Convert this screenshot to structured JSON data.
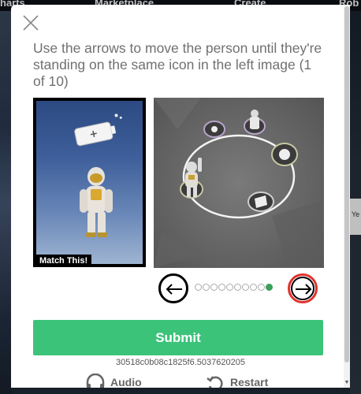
{
  "background_nav": {
    "items": [
      "harts",
      "Marketplace",
      "Create",
      "Rob"
    ]
  },
  "background_tile_text": "Ye",
  "modal": {
    "instructions": "Use the arrows to move the person until they're standing on the same icon in the left image (1 of 10)",
    "match_label": "Match This!",
    "submit_label": "Submit",
    "session_id": "30518c0b08c1825f6.5037620205",
    "audio_label": "Audio",
    "restart_label": "Restart",
    "progress": {
      "total": 10,
      "current": 10
    }
  },
  "colors": {
    "submit": "#3cc37a",
    "active_dot": "#3aa05a",
    "next_arrow_ring": "#e0322e",
    "instruction_text": "#707070"
  },
  "icons": {
    "close": "close-icon",
    "prev": "arrow-left-icon",
    "next": "arrow-right-icon",
    "audio": "headphones-icon",
    "restart": "restart-icon",
    "battery": "battery-icon"
  }
}
